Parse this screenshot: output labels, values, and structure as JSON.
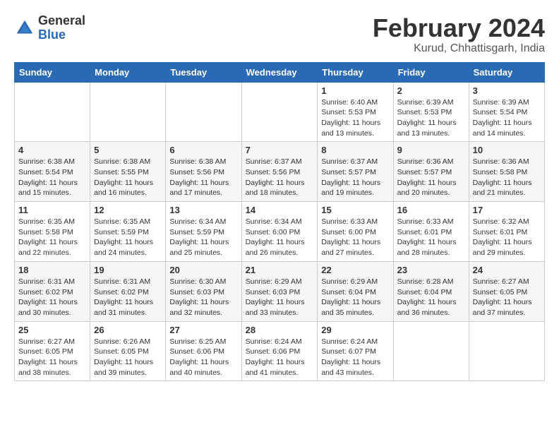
{
  "logo": {
    "general": "General",
    "blue": "Blue"
  },
  "title": "February 2024",
  "subtitle": "Kurud, Chhattisgarh, India",
  "days_of_week": [
    "Sunday",
    "Monday",
    "Tuesday",
    "Wednesday",
    "Thursday",
    "Friday",
    "Saturday"
  ],
  "weeks": [
    [
      {
        "day": "",
        "info": ""
      },
      {
        "day": "",
        "info": ""
      },
      {
        "day": "",
        "info": ""
      },
      {
        "day": "",
        "info": ""
      },
      {
        "day": "1",
        "info": "Sunrise: 6:40 AM\nSunset: 5:53 PM\nDaylight: 11 hours and 13 minutes."
      },
      {
        "day": "2",
        "info": "Sunrise: 6:39 AM\nSunset: 5:53 PM\nDaylight: 11 hours and 13 minutes."
      },
      {
        "day": "3",
        "info": "Sunrise: 6:39 AM\nSunset: 5:54 PM\nDaylight: 11 hours and 14 minutes."
      }
    ],
    [
      {
        "day": "4",
        "info": "Sunrise: 6:38 AM\nSunset: 5:54 PM\nDaylight: 11 hours and 15 minutes."
      },
      {
        "day": "5",
        "info": "Sunrise: 6:38 AM\nSunset: 5:55 PM\nDaylight: 11 hours and 16 minutes."
      },
      {
        "day": "6",
        "info": "Sunrise: 6:38 AM\nSunset: 5:56 PM\nDaylight: 11 hours and 17 minutes."
      },
      {
        "day": "7",
        "info": "Sunrise: 6:37 AM\nSunset: 5:56 PM\nDaylight: 11 hours and 18 minutes."
      },
      {
        "day": "8",
        "info": "Sunrise: 6:37 AM\nSunset: 5:57 PM\nDaylight: 11 hours and 19 minutes."
      },
      {
        "day": "9",
        "info": "Sunrise: 6:36 AM\nSunset: 5:57 PM\nDaylight: 11 hours and 20 minutes."
      },
      {
        "day": "10",
        "info": "Sunrise: 6:36 AM\nSunset: 5:58 PM\nDaylight: 11 hours and 21 minutes."
      }
    ],
    [
      {
        "day": "11",
        "info": "Sunrise: 6:35 AM\nSunset: 5:58 PM\nDaylight: 11 hours and 22 minutes."
      },
      {
        "day": "12",
        "info": "Sunrise: 6:35 AM\nSunset: 5:59 PM\nDaylight: 11 hours and 24 minutes."
      },
      {
        "day": "13",
        "info": "Sunrise: 6:34 AM\nSunset: 5:59 PM\nDaylight: 11 hours and 25 minutes."
      },
      {
        "day": "14",
        "info": "Sunrise: 6:34 AM\nSunset: 6:00 PM\nDaylight: 11 hours and 26 minutes."
      },
      {
        "day": "15",
        "info": "Sunrise: 6:33 AM\nSunset: 6:00 PM\nDaylight: 11 hours and 27 minutes."
      },
      {
        "day": "16",
        "info": "Sunrise: 6:33 AM\nSunset: 6:01 PM\nDaylight: 11 hours and 28 minutes."
      },
      {
        "day": "17",
        "info": "Sunrise: 6:32 AM\nSunset: 6:01 PM\nDaylight: 11 hours and 29 minutes."
      }
    ],
    [
      {
        "day": "18",
        "info": "Sunrise: 6:31 AM\nSunset: 6:02 PM\nDaylight: 11 hours and 30 minutes."
      },
      {
        "day": "19",
        "info": "Sunrise: 6:31 AM\nSunset: 6:02 PM\nDaylight: 11 hours and 31 minutes."
      },
      {
        "day": "20",
        "info": "Sunrise: 6:30 AM\nSunset: 6:03 PM\nDaylight: 11 hours and 32 minutes."
      },
      {
        "day": "21",
        "info": "Sunrise: 6:29 AM\nSunset: 6:03 PM\nDaylight: 11 hours and 33 minutes."
      },
      {
        "day": "22",
        "info": "Sunrise: 6:29 AM\nSunset: 6:04 PM\nDaylight: 11 hours and 35 minutes."
      },
      {
        "day": "23",
        "info": "Sunrise: 6:28 AM\nSunset: 6:04 PM\nDaylight: 11 hours and 36 minutes."
      },
      {
        "day": "24",
        "info": "Sunrise: 6:27 AM\nSunset: 6:05 PM\nDaylight: 11 hours and 37 minutes."
      }
    ],
    [
      {
        "day": "25",
        "info": "Sunrise: 6:27 AM\nSunset: 6:05 PM\nDaylight: 11 hours and 38 minutes."
      },
      {
        "day": "26",
        "info": "Sunrise: 6:26 AM\nSunset: 6:05 PM\nDaylight: 11 hours and 39 minutes."
      },
      {
        "day": "27",
        "info": "Sunrise: 6:25 AM\nSunset: 6:06 PM\nDaylight: 11 hours and 40 minutes."
      },
      {
        "day": "28",
        "info": "Sunrise: 6:24 AM\nSunset: 6:06 PM\nDaylight: 11 hours and 41 minutes."
      },
      {
        "day": "29",
        "info": "Sunrise: 6:24 AM\nSunset: 6:07 PM\nDaylight: 11 hours and 43 minutes."
      },
      {
        "day": "",
        "info": ""
      },
      {
        "day": "",
        "info": ""
      }
    ]
  ]
}
